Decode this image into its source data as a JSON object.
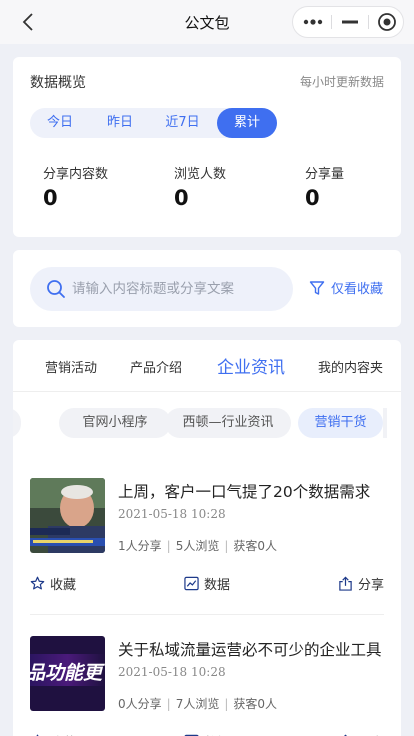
{
  "header": {
    "title": "公文包",
    "back_icon": "chevron-left-icon",
    "capsule_icons": [
      "more-dots-icon",
      "minimize-icon",
      "target-icon"
    ]
  },
  "overview": {
    "title": "数据概览",
    "note": "每小时更新数据",
    "ranges": [
      "今日",
      "昨日",
      "近7日",
      "累计"
    ],
    "active_range": "累计",
    "stats": [
      {
        "label": "分享内容数",
        "value": "0"
      },
      {
        "label": "浏览人数",
        "value": "0"
      },
      {
        "label": "分享量",
        "value": "0"
      }
    ]
  },
  "search": {
    "placeholder": "请输入内容标题或分享文案",
    "value": "",
    "filter_label": "仅看收藏"
  },
  "tabs": [
    "营销活动",
    "产品介绍",
    "企业资讯",
    "我的内容夹"
  ],
  "active_tab": "企业资讯",
  "chips": [
    "官网小程序",
    "西顿—行业资讯",
    "营销干货"
  ],
  "active_chip": "营销干货",
  "items": [
    {
      "title": "上周，客户一口气提了20个数据需求",
      "date": "2021-05-18 10:28",
      "shares": "1人分享",
      "views": "5人浏览",
      "customers": "获客0人"
    },
    {
      "title": "关于私域流量运营必不可少的企业工具",
      "date": "2021-05-18 10:28",
      "shares": "0人分享",
      "views": "7人浏览",
      "customers": "获客0人",
      "thumb_text": "品功能更"
    }
  ],
  "actions": {
    "favorite": "收藏",
    "data": "数据",
    "share": "分享"
  },
  "colors": {
    "accent": "#3f6ff0",
    "background": "#eef0f6"
  }
}
